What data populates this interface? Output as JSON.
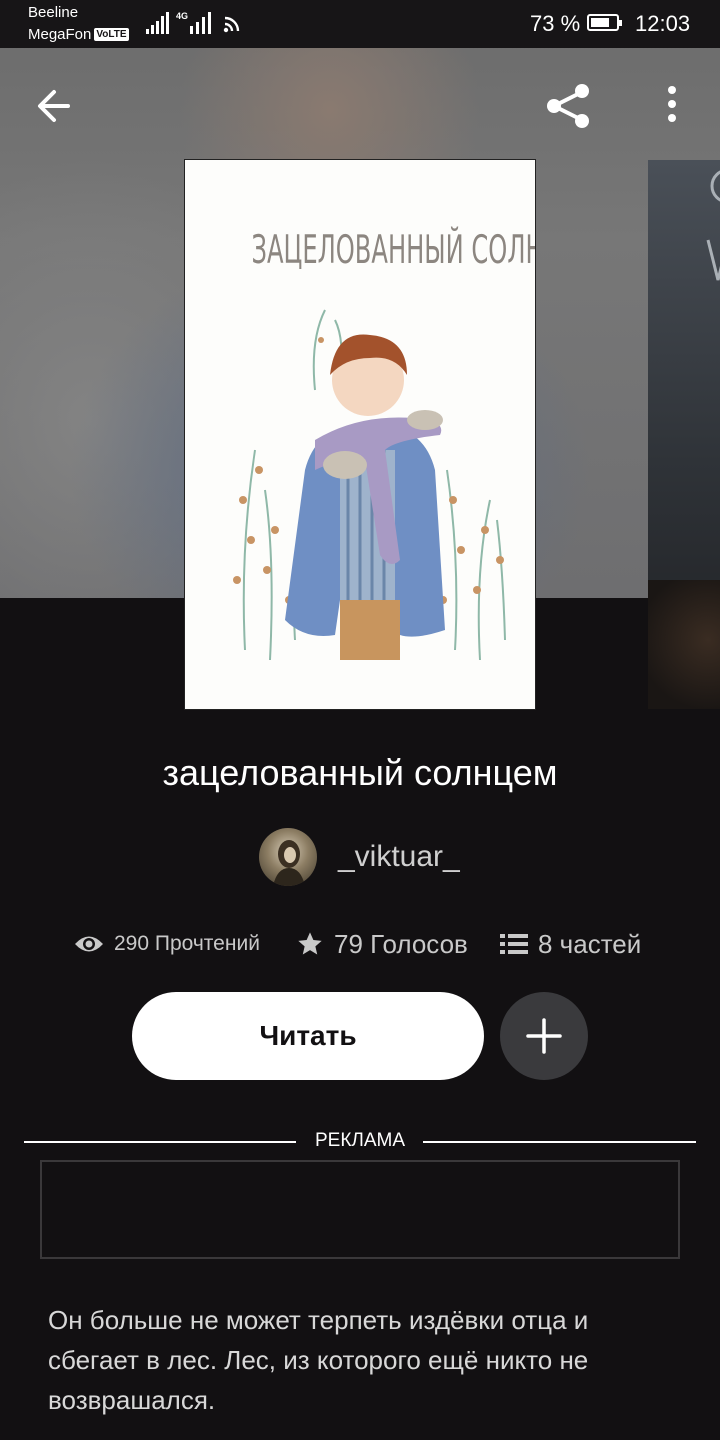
{
  "status_bar": {
    "carrier_1": "Beeline",
    "carrier_2": "MegaFon",
    "volte_badge": "VoLTE",
    "network": "4G",
    "battery_percent": "73 %",
    "battery_level": 0.73,
    "time": "12:03"
  },
  "toolbar": {
    "back_icon": "arrow-left-icon",
    "share_icon": "share-icon",
    "more_icon": "more-vertical-icon"
  },
  "book": {
    "cover_title": "ЗАЦЕЛОВАННЫЙ СОЛНЦЕМ",
    "title": "зацелованный солнцем",
    "author": "_viktuar_",
    "reads": "290 Прочтений",
    "votes": "79 Голосов",
    "parts": "8 частей",
    "description": "Он больше не может терпеть издёвки отца и сбегает в лес. Лес, из которого ещё никто не возврашался."
  },
  "actions": {
    "read_label": "Читать",
    "add_icon": "plus-icon"
  },
  "ad": {
    "label": "РЕКЛАМА"
  },
  "colors": {
    "background": "#121012",
    "button_primary": "#ffffff",
    "button_secondary": "#3a3a3d",
    "text_muted": "#c9c9c9"
  }
}
